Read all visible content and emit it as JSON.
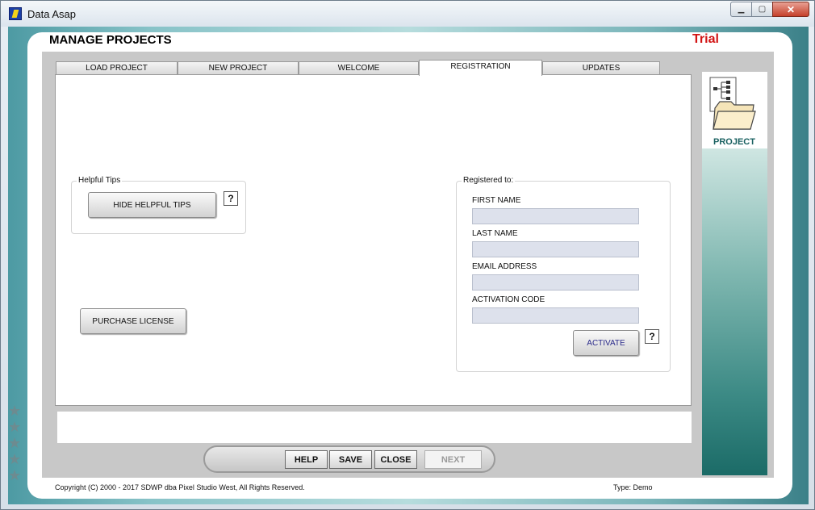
{
  "window": {
    "title": "Data Asap",
    "min": "▁",
    "max": "▢",
    "close": "✕"
  },
  "header": {
    "title": "MANAGE PROJECTS",
    "badge": "Trial",
    "badge_color": "#d21414"
  },
  "tabs": [
    {
      "label": "LOAD PROJECT"
    },
    {
      "label": "NEW PROJECT"
    },
    {
      "label": "WELCOME"
    },
    {
      "label": "REGISTRATION"
    },
    {
      "label": "UPDATES"
    }
  ],
  "helpful_tips": {
    "group_label": "Helpful Tips",
    "button": "HIDE HELPFUL TIPS",
    "help": "?"
  },
  "purchase": {
    "button": "PURCHASE LICENSE"
  },
  "registration": {
    "group_label": "Registered to:",
    "first_name": {
      "label": "FIRST NAME",
      "value": ""
    },
    "last_name": {
      "label": "LAST NAME",
      "value": ""
    },
    "email": {
      "label": "EMAIL ADDRESS",
      "value": ""
    },
    "activation_code": {
      "label": "ACTIVATION CODE",
      "value": ""
    },
    "activate_button": "ACTIVATE",
    "help": "?"
  },
  "nav": {
    "help": "HELP",
    "save": "SAVE",
    "close": "CLOSE",
    "next": "NEXT"
  },
  "side": {
    "label": "PROJECT",
    "icon": "project-folder-icon"
  },
  "footer": {
    "copyright": "Copyright (C) 2000 - 2017 SDWP dba Pixel Studio West, All Rights Reserved.",
    "type": "Type: Demo"
  }
}
